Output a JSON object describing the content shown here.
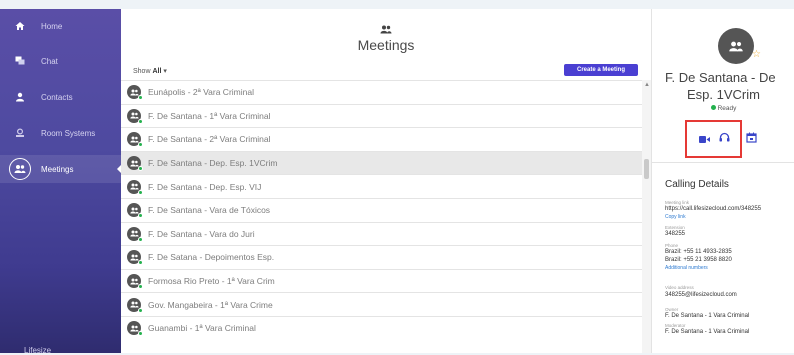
{
  "sidebar": {
    "items": [
      {
        "label": "Home",
        "icon": "home-icon"
      },
      {
        "label": "Chat",
        "icon": "chat-icon"
      },
      {
        "label": "Contacts",
        "icon": "person-icon"
      },
      {
        "label": "Room Systems",
        "icon": "room-system-icon"
      },
      {
        "label": "Meetings",
        "icon": "meetings-icon",
        "active": true
      }
    ],
    "bottom_logo": "Lifesize"
  },
  "main": {
    "title": "Meetings",
    "filter_label": "Show",
    "filter_value": "All",
    "create_label": "Create a Meeting",
    "meetings": [
      "Eunápolis - 2ª Vara Criminal",
      "F. De Santana - 1ª Vara Criminal",
      "F. De Santana - 2ª Vara Criminal",
      "F. De Santana - Dep. Esp. 1VCrim",
      "F. De Santana - Dep. Esp. VIJ",
      "F. De Santana - Vara de Tóxicos",
      "F. De Santana - Vara do Juri",
      "F. De Satana - Depoimentos Esp.",
      "Formosa Rio Preto - 1ª Vara Crim",
      "Gov. Mangabeira - 1ª Vara Crime",
      "Guanambi - 1ª Vara Criminal"
    ],
    "selected_index": 3
  },
  "details": {
    "name": "F. De Santana - De",
    "subtitle": "Esp. 1VCrim",
    "status": "Ready",
    "section_title": "Calling Details",
    "meeting_link_label": "Meeting link",
    "meeting_link": "https://call.lifesizecloud.com/348255",
    "copy_link": "Copy link",
    "extension_label": "Extension",
    "extension": "348255",
    "phone_label": "Phone",
    "phone1": "Brazil: +55 11 4933-2835",
    "phone2": "Brazil: +55 21 3958 8820",
    "additional_numbers": "Additional numbers",
    "video_label": "Video address",
    "video_address": "348255@lifesizecloud.com",
    "owner_label": "Owner",
    "owner": "F. De Santana - 1 Vara Criminal",
    "moderator_label": "Moderator",
    "moderator": "F. De Santana - 1 Vara Criminal"
  },
  "colors": {
    "accent": "#4a3fd2",
    "status_green": "#23b14d",
    "highlight_red": "#e53935",
    "action_blue": "#3a45c9"
  }
}
